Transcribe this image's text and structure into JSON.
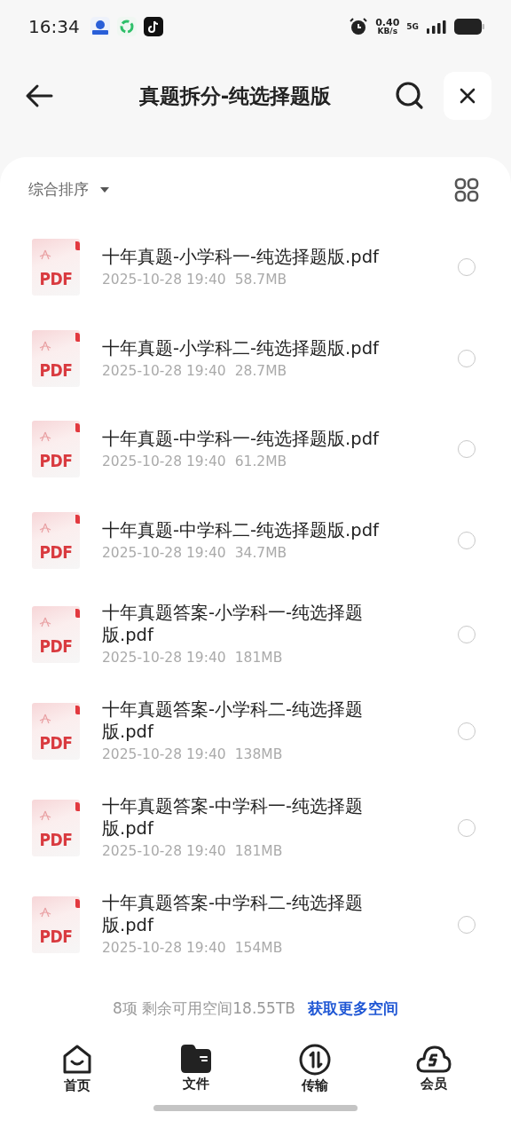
{
  "status_bar": {
    "time": "16:34",
    "speed_value": "0.40",
    "speed_unit": "KB/s",
    "network": "5G"
  },
  "header": {
    "title": "真题拆分-纯选择题版"
  },
  "toolbar": {
    "sort_label": "综合排序"
  },
  "files": [
    {
      "badge": "PDF",
      "name": "十年真题-小学科一-纯选择题版.pdf",
      "date": "2025-10-28 19:40",
      "size": "58.7MB",
      "selected": false
    },
    {
      "badge": "PDF",
      "name": "十年真题-小学科二-纯选择题版.pdf",
      "date": "2025-10-28 19:40",
      "size": "28.7MB",
      "selected": false
    },
    {
      "badge": "PDF",
      "name": "十年真题-中学科一-纯选择题版.pdf",
      "date": "2025-10-28 19:40",
      "size": "61.2MB",
      "selected": false
    },
    {
      "badge": "PDF",
      "name": "十年真题-中学科二-纯选择题版.pdf",
      "date": "2025-10-28 19:40",
      "size": "34.7MB",
      "selected": false
    },
    {
      "badge": "PDF",
      "name": "十年真题答案-小学科一-纯选择题版.pdf",
      "date": "2025-10-28 19:40",
      "size": "181MB",
      "selected": false
    },
    {
      "badge": "PDF",
      "name": "十年真题答案-小学科二-纯选择题版.pdf",
      "date": "2025-10-28 19:40",
      "size": "138MB",
      "selected": false
    },
    {
      "badge": "PDF",
      "name": "十年真题答案-中学科一-纯选择题版.pdf",
      "date": "2025-10-28 19:40",
      "size": "181MB",
      "selected": false
    },
    {
      "badge": "PDF",
      "name": "十年真题答案-中学科二-纯选择题版.pdf",
      "date": "2025-10-28 19:40",
      "size": "154MB",
      "selected": false
    }
  ],
  "footer": {
    "summary": "8项 剩余可用空间18.55TB",
    "link": "获取更多空间"
  },
  "nav": [
    {
      "kind": "home",
      "label": "首页",
      "selected": false
    },
    {
      "kind": "files",
      "label": "文件",
      "selected": true
    },
    {
      "kind": "transfer",
      "label": "传输",
      "selected": false
    },
    {
      "kind": "vip",
      "label": "会员",
      "selected": false
    }
  ]
}
